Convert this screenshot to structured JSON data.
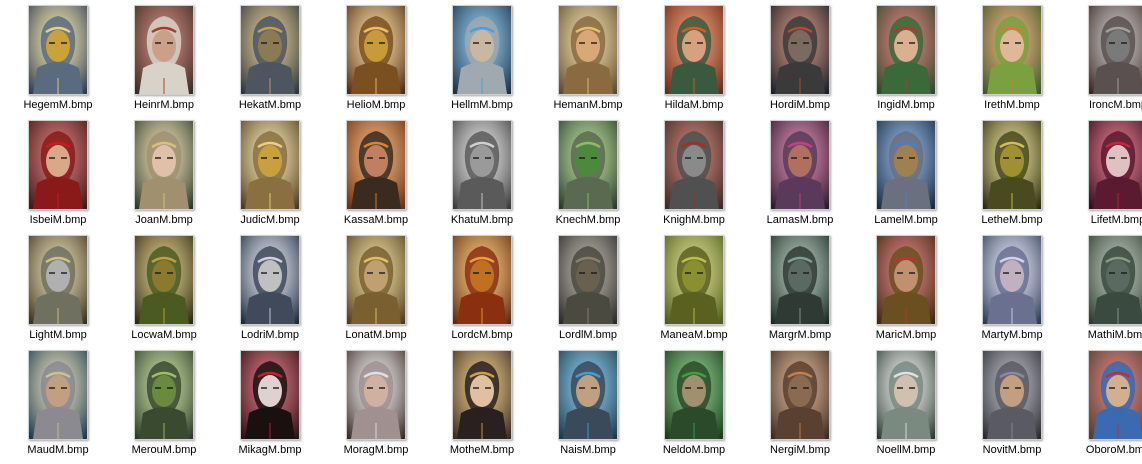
{
  "files": [
    {
      "name": "HegemM.bmp",
      "bg": "#2b3a55",
      "face": "#c9a23a",
      "accent": "#e8d27a",
      "hood": "#5a6b80"
    },
    {
      "name": "HeinrM.bmp",
      "bg": "#3b2b25",
      "face": "#c9a08a",
      "accent": "#a33a2a",
      "hood": "#d9d2c8"
    },
    {
      "name": "HekatM.bmp",
      "bg": "#2a3540",
      "face": "#8a7a55",
      "accent": "#c9a04a",
      "hood": "#4d5560"
    },
    {
      "name": "HelioM.bmp",
      "bg": "#4a2a18",
      "face": "#c99a3a",
      "accent": "#f0c060",
      "hood": "#7a5020"
    },
    {
      "name": "HellmM.bmp",
      "bg": "#1c2f45",
      "face": "#c9b8a0",
      "accent": "#4aa0d9",
      "hood": "#a0a8b0"
    },
    {
      "name": "HemanM.bmp",
      "bg": "#5a4a30",
      "face": "#d9a878",
      "accent": "#e0c070",
      "hood": "#8a6a40"
    },
    {
      "name": "HildaM.bmp",
      "bg": "#6a2a18",
      "face": "#d9a080",
      "accent": "#d95a20",
      "hood": "#3a5a40"
    },
    {
      "name": "HordiM.bmp",
      "bg": "#15202a",
      "face": "#7a6a60",
      "accent": "#b04a30",
      "hood": "#3a3a3a"
    },
    {
      "name": "IngidM.bmp",
      "bg": "#2a4a2a",
      "face": "#d9b090",
      "accent": "#c03030",
      "hood": "#3a6a3a"
    },
    {
      "name": "IrethM.bmp",
      "bg": "#3a5a2a",
      "face": "#e0b898",
      "accent": "#d97a30",
      "hood": "#7aa040"
    },
    {
      "name": "IroncM.bmp",
      "bg": "#3a2520",
      "face": "#7a7a7a",
      "accent": "#a0a0a0",
      "hood": "#5a5050"
    },
    {
      "name": "IsbeiM.bmp",
      "bg": "#3a1a1a",
      "face": "#d9a888",
      "accent": "#c02020",
      "hood": "#8a1a1a"
    },
    {
      "name": "JoanM.bmp",
      "bg": "#2a3a2a",
      "face": "#e0c0a8",
      "accent": "#d9c080",
      "hood": "#a09070"
    },
    {
      "name": "JudicM.bmp",
      "bg": "#4a3a20",
      "face": "#c9a040",
      "accent": "#e8d080",
      "hood": "#8a7040"
    },
    {
      "name": "KassaM.bmp",
      "bg": "#6a3010",
      "face": "#c08060",
      "accent": "#e08030",
      "hood": "#3a2a20"
    },
    {
      "name": "KhatuM.bmp",
      "bg": "#3a3a3a",
      "face": "#9a9a9a",
      "accent": "#d0d0d0",
      "hood": "#5a5a5a"
    },
    {
      "name": "KnechM.bmp",
      "bg": "#2a3a2a",
      "face": "#4a8a3a",
      "accent": "#8ac060",
      "hood": "#5a6a50"
    },
    {
      "name": "KnighM.bmp",
      "bg": "#3a2a25",
      "face": "#8a8a8a",
      "accent": "#a03020",
      "hood": "#505050"
    },
    {
      "name": "LamasM.bmp",
      "bg": "#2a1a2a",
      "face": "#b07060",
      "accent": "#c04080",
      "hood": "#5a3a5a"
    },
    {
      "name": "LamelM.bmp",
      "bg": "#1a2a40",
      "face": "#a08050",
      "accent": "#4a80c0",
      "hood": "#6a7080"
    },
    {
      "name": "LetheM.bmp",
      "bg": "#2a2a10",
      "face": "#a09030",
      "accent": "#d0c050",
      "hood": "#4a4a20"
    },
    {
      "name": "LifetM.bmp",
      "bg": "#2a1020",
      "face": "#e0c0c0",
      "accent": "#d02040",
      "hood": "#5a1a30"
    },
    {
      "name": "LightM.bmp",
      "bg": "#3a3020",
      "face": "#b0b0b0",
      "accent": "#d0c080",
      "hood": "#707060"
    },
    {
      "name": "LocwaM.bmp",
      "bg": "#2a2a10",
      "face": "#8a7a30",
      "accent": "#c0a040",
      "hood": "#4a5a20"
    },
    {
      "name": "LodriM.bmp",
      "bg": "#1a2a3a",
      "face": "#c0c0c0",
      "accent": "#d0d0e0",
      "hood": "#404a5a"
    },
    {
      "name": "LonatM.bmp",
      "bg": "#4a3a20",
      "face": "#c0a070",
      "accent": "#e0c060",
      "hood": "#7a6030"
    },
    {
      "name": "LordcM.bmp",
      "bg": "#5a2a10",
      "face": "#c07020",
      "accent": "#f0a030",
      "hood": "#8a3010"
    },
    {
      "name": "LordlM.bmp",
      "bg": "#2a2a2a",
      "face": "#6a6050",
      "accent": "#8a8070",
      "hood": "#4a4a40"
    },
    {
      "name": "ManeaM.bmp",
      "bg": "#4a5a20",
      "face": "#8a9030",
      "accent": "#c0c040",
      "hood": "#5a6020"
    },
    {
      "name": "MargrM.bmp",
      "bg": "#1a2a20",
      "face": "#5a6a60",
      "accent": "#80a090",
      "hood": "#303a35"
    },
    {
      "name": "MaricM.bmp",
      "bg": "#3a2a10",
      "face": "#c09070",
      "accent": "#c03030",
      "hood": "#6a5020"
    },
    {
      "name": "MartyM.bmp",
      "bg": "#2a3a50",
      "face": "#c0b0c0",
      "accent": "#d0d0f0",
      "hood": "#6a7090"
    },
    {
      "name": "MathiM.bmp",
      "bg": "#2a3a30",
      "face": "#5a6a60",
      "accent": "#8a9a80",
      "hood": "#3a4a40"
    },
    {
      "name": "MaudM.bmp",
      "bg": "#1a3a50",
      "face": "#c0a080",
      "accent": "#d0c090",
      "hood": "#8a8a90"
    },
    {
      "name": "MerouM.bmp",
      "bg": "#2a3a2a",
      "face": "#6a8a40",
      "accent": "#a0c060",
      "hood": "#3a4a30"
    },
    {
      "name": "MikagM.bmp",
      "bg": "#2a1015",
      "face": "#e0d0d0",
      "accent": "#c02030",
      "hood": "#1a1010"
    },
    {
      "name": "MoragM.bmp",
      "bg": "#3a2a25",
      "face": "#d0b0a0",
      "accent": "#e0e0e0",
      "hood": "#a09090"
    },
    {
      "name": "MotheM.bmp",
      "bg": "#3a2a20",
      "face": "#e0c0a0",
      "accent": "#d0a040",
      "hood": "#2a2020"
    },
    {
      "name": "NaisM.bmp",
      "bg": "#1a3a4a",
      "face": "#c0a080",
      "accent": "#40a0d0",
      "hood": "#3a4a5a"
    },
    {
      "name": "NeldoM.bmp",
      "bg": "#1a3a1a",
      "face": "#a09070",
      "accent": "#40a040",
      "hood": "#2a4a2a"
    },
    {
      "name": "NergiM.bmp",
      "bg": "#3a2a20",
      "face": "#8a6a50",
      "accent": "#c08050",
      "hood": "#5a4030"
    },
    {
      "name": "NoellM.bmp",
      "bg": "#2a3a30",
      "face": "#d0c0b0",
      "accent": "#e0e0e0",
      "hood": "#7a8a80"
    },
    {
      "name": "NovitM.bmp",
      "bg": "#2a2a30",
      "face": "#c0a080",
      "accent": "#8a8a9a",
      "hood": "#5a5a65"
    },
    {
      "name": "OboroM.bmp",
      "bg": "#4a4030",
      "face": "#d0b090",
      "accent": "#c03030",
      "hood": "#3a6ab0"
    }
  ]
}
